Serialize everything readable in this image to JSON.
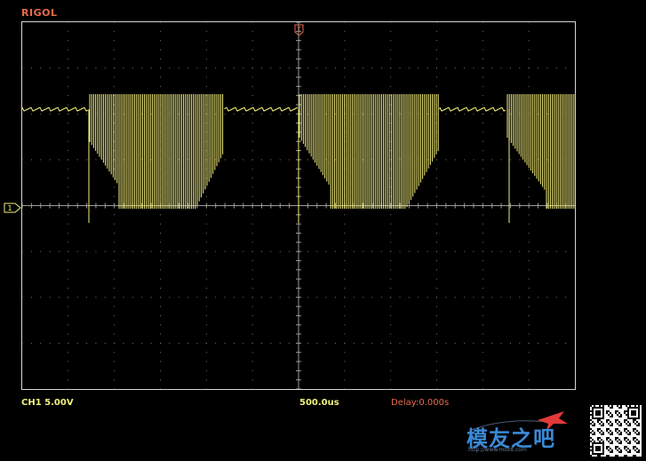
{
  "header": {
    "brand": "RIGOL"
  },
  "status_bar": {
    "channel_scale": "CH1 5.00V",
    "timebase": "500.0us",
    "delay": "Delay:0.000s"
  },
  "markers": {
    "trigger": "T",
    "channel": "1"
  },
  "watermark": {
    "logo_text": "模友之吧",
    "logo_subtext": "http://www.moz8.com"
  },
  "colors": {
    "brand": "#e86a4a",
    "trace": "#f5f07a",
    "grid_dots": "#7a7a7a",
    "frame": "#d6d6d6",
    "status_text": "#f0f07a",
    "delay_text": "#e86a4a",
    "logo_blue": "#3a8ad6",
    "logo_red": "#e23a3a"
  }
}
